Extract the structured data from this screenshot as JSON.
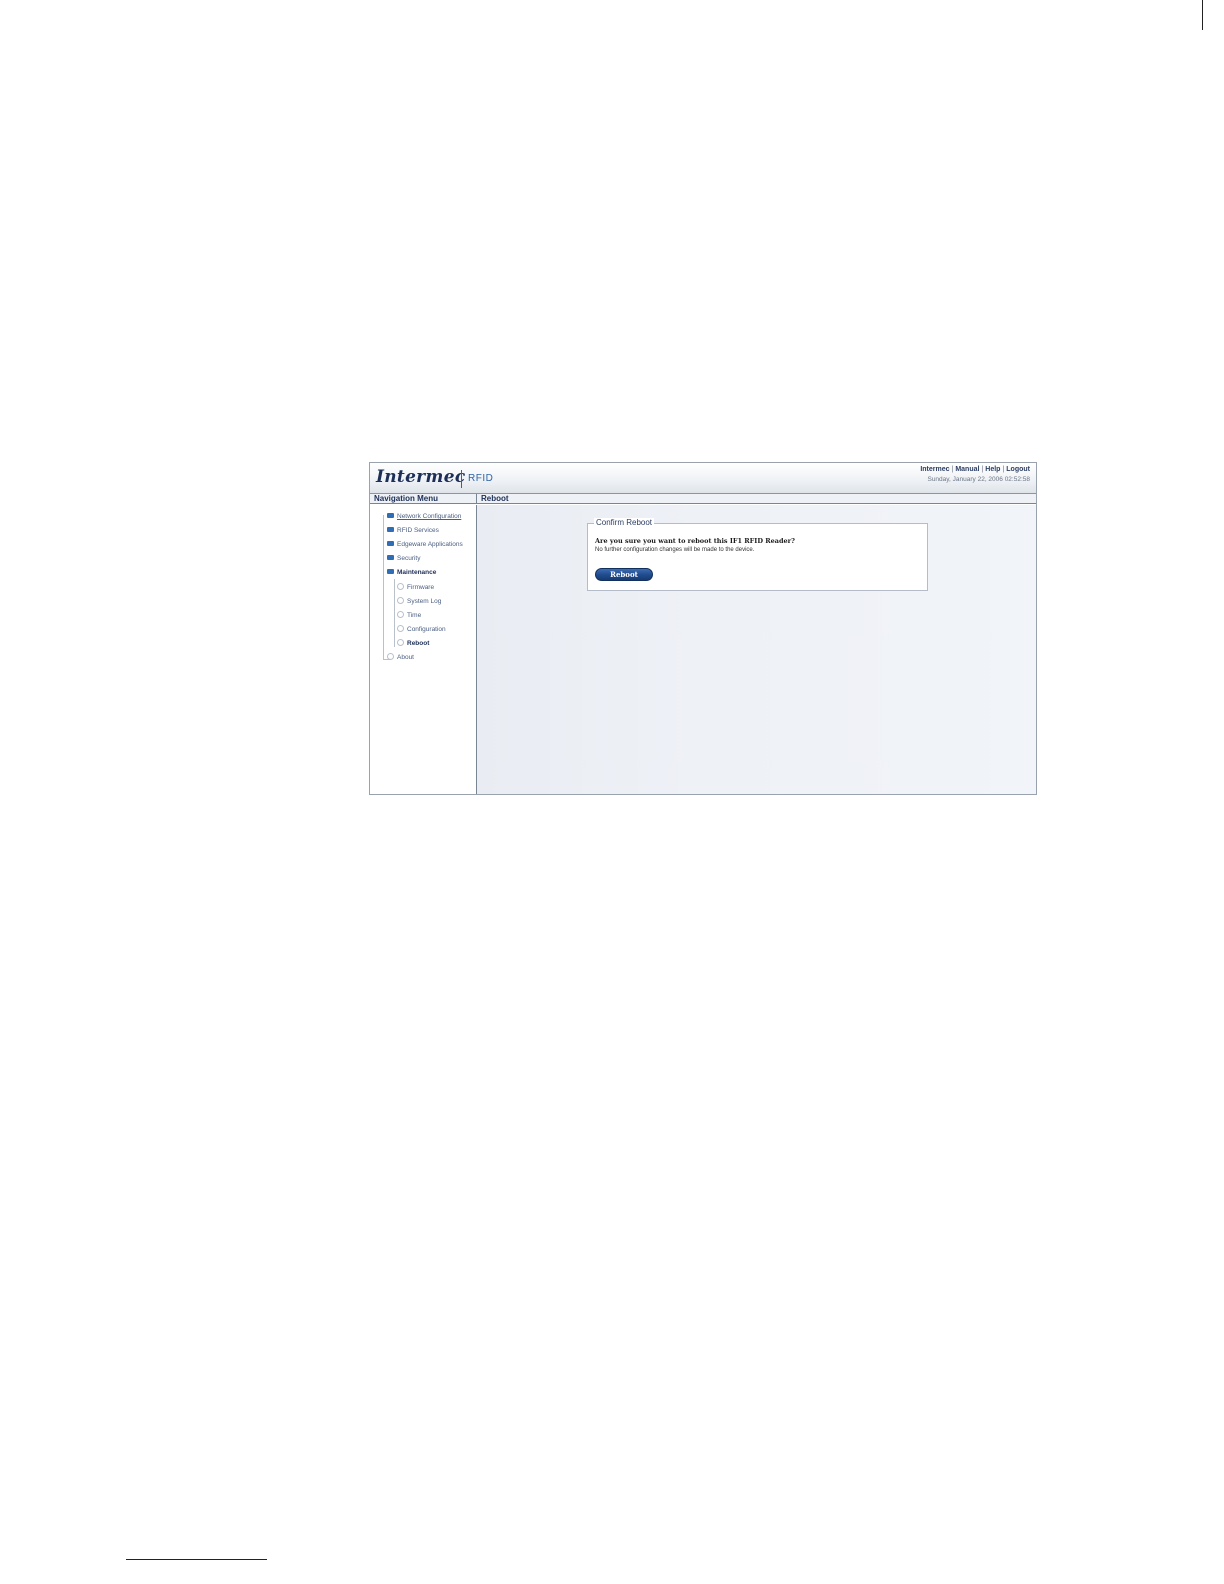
{
  "header": {
    "logo": "Intermec",
    "product": "RFID",
    "links": [
      "Intermec",
      "Manual",
      "Help",
      "Logout"
    ],
    "datetime": "Sunday, January 22, 2006 02:52:58"
  },
  "nav_title": "Navigation Menu",
  "page_title": "Reboot",
  "nav": {
    "items": [
      {
        "label": "Network Configuration"
      },
      {
        "label": "RFID Services"
      },
      {
        "label": "Edgeware Applications"
      },
      {
        "label": "Security"
      },
      {
        "label": "Maintenance"
      },
      {
        "label": "Firmware"
      },
      {
        "label": "System Log"
      },
      {
        "label": "Time"
      },
      {
        "label": "Configuration"
      },
      {
        "label": "Reboot"
      },
      {
        "label": "About"
      }
    ]
  },
  "confirm": {
    "legend": "Confirm Reboot",
    "question": "Are you sure you want to reboot this IF1 RFID Reader?",
    "note": "No further configuration changes will be made to the device.",
    "button": "Reboot"
  },
  "colors": {
    "brand": "#1d2f57",
    "accent": "#2c64a8",
    "button": "#1f4a8c"
  }
}
